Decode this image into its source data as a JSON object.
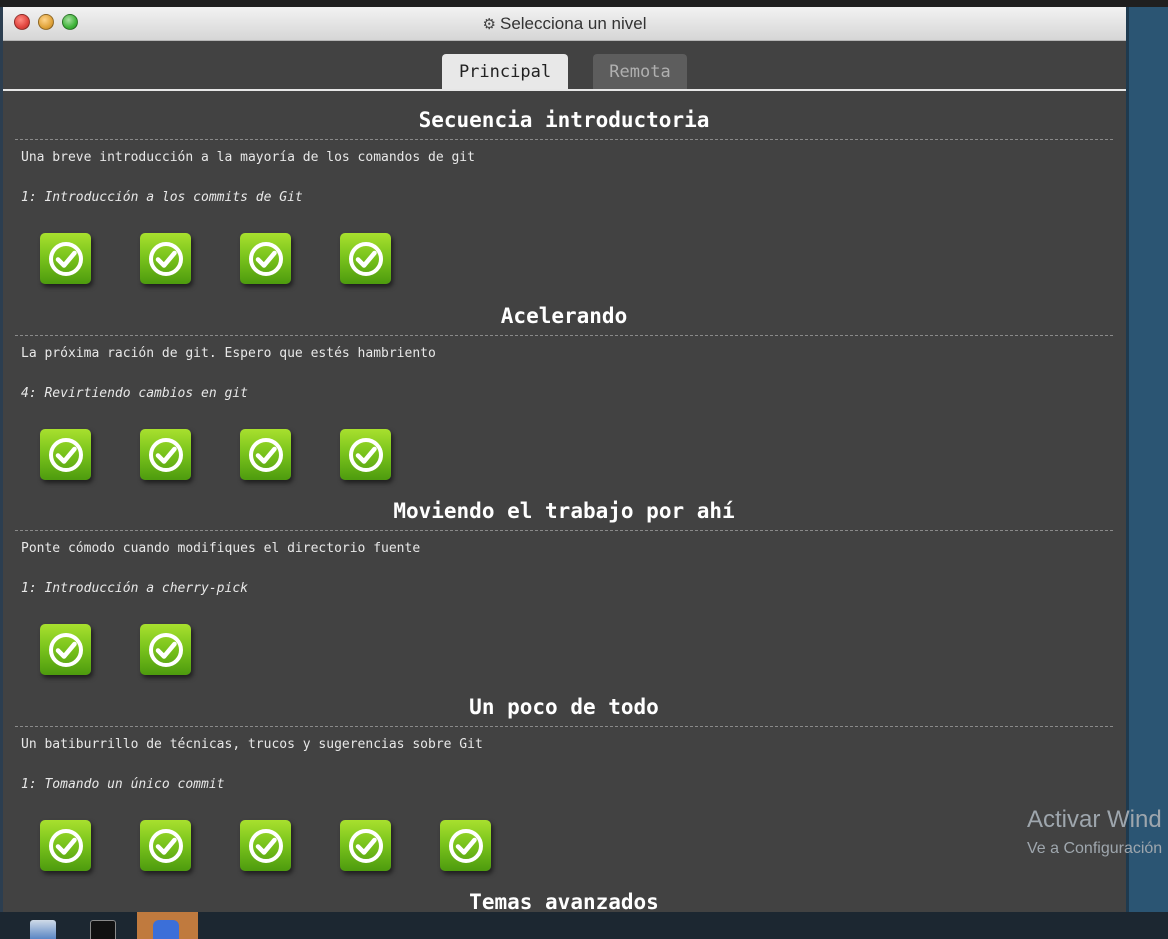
{
  "window": {
    "title": "Selecciona un nivel",
    "title_icon": "gear-icon"
  },
  "tabs": [
    {
      "label": "Principal",
      "active": true
    },
    {
      "label": "Remota",
      "active": false
    }
  ],
  "sequences": [
    {
      "title": "Secuencia introductoria",
      "about": "Una breve introducción a la mayoría de los comandos de git",
      "selected_level": "1: Introducción a los commits de Git",
      "levels": [
        {
          "status": "completed"
        },
        {
          "status": "completed"
        },
        {
          "status": "completed"
        },
        {
          "status": "completed"
        }
      ]
    },
    {
      "title": "Acelerando",
      "about": "La próxima ración de git. Espero que estés hambriento",
      "selected_level": "4: Revirtiendo cambios en git",
      "levels": [
        {
          "status": "completed"
        },
        {
          "status": "completed"
        },
        {
          "status": "completed"
        },
        {
          "status": "completed"
        }
      ]
    },
    {
      "title": "Moviendo el trabajo por ahí",
      "about": "Ponte cómodo cuando modifiques el directorio fuente",
      "selected_level": "1: Introducción a cherry-pick",
      "levels": [
        {
          "status": "completed"
        },
        {
          "status": "completed"
        }
      ]
    },
    {
      "title": "Un poco de todo",
      "about": "Un batiburrillo de técnicas, trucos y sugerencias sobre Git",
      "selected_level": "1: Tomando un único commit",
      "levels": [
        {
          "status": "completed"
        },
        {
          "status": "completed"
        },
        {
          "status": "completed"
        },
        {
          "status": "completed"
        },
        {
          "status": "completed"
        }
      ]
    },
    {
      "title": "Temas avanzados",
      "about": "",
      "selected_level": "",
      "levels": []
    }
  ],
  "watermark": {
    "line1": "Activar Wind",
    "line2": "Ve a Configuración"
  },
  "colors": {
    "window_bg": "#424242",
    "level_complete_top": "#a8e02e",
    "level_complete_bottom": "#4d9b0e"
  }
}
